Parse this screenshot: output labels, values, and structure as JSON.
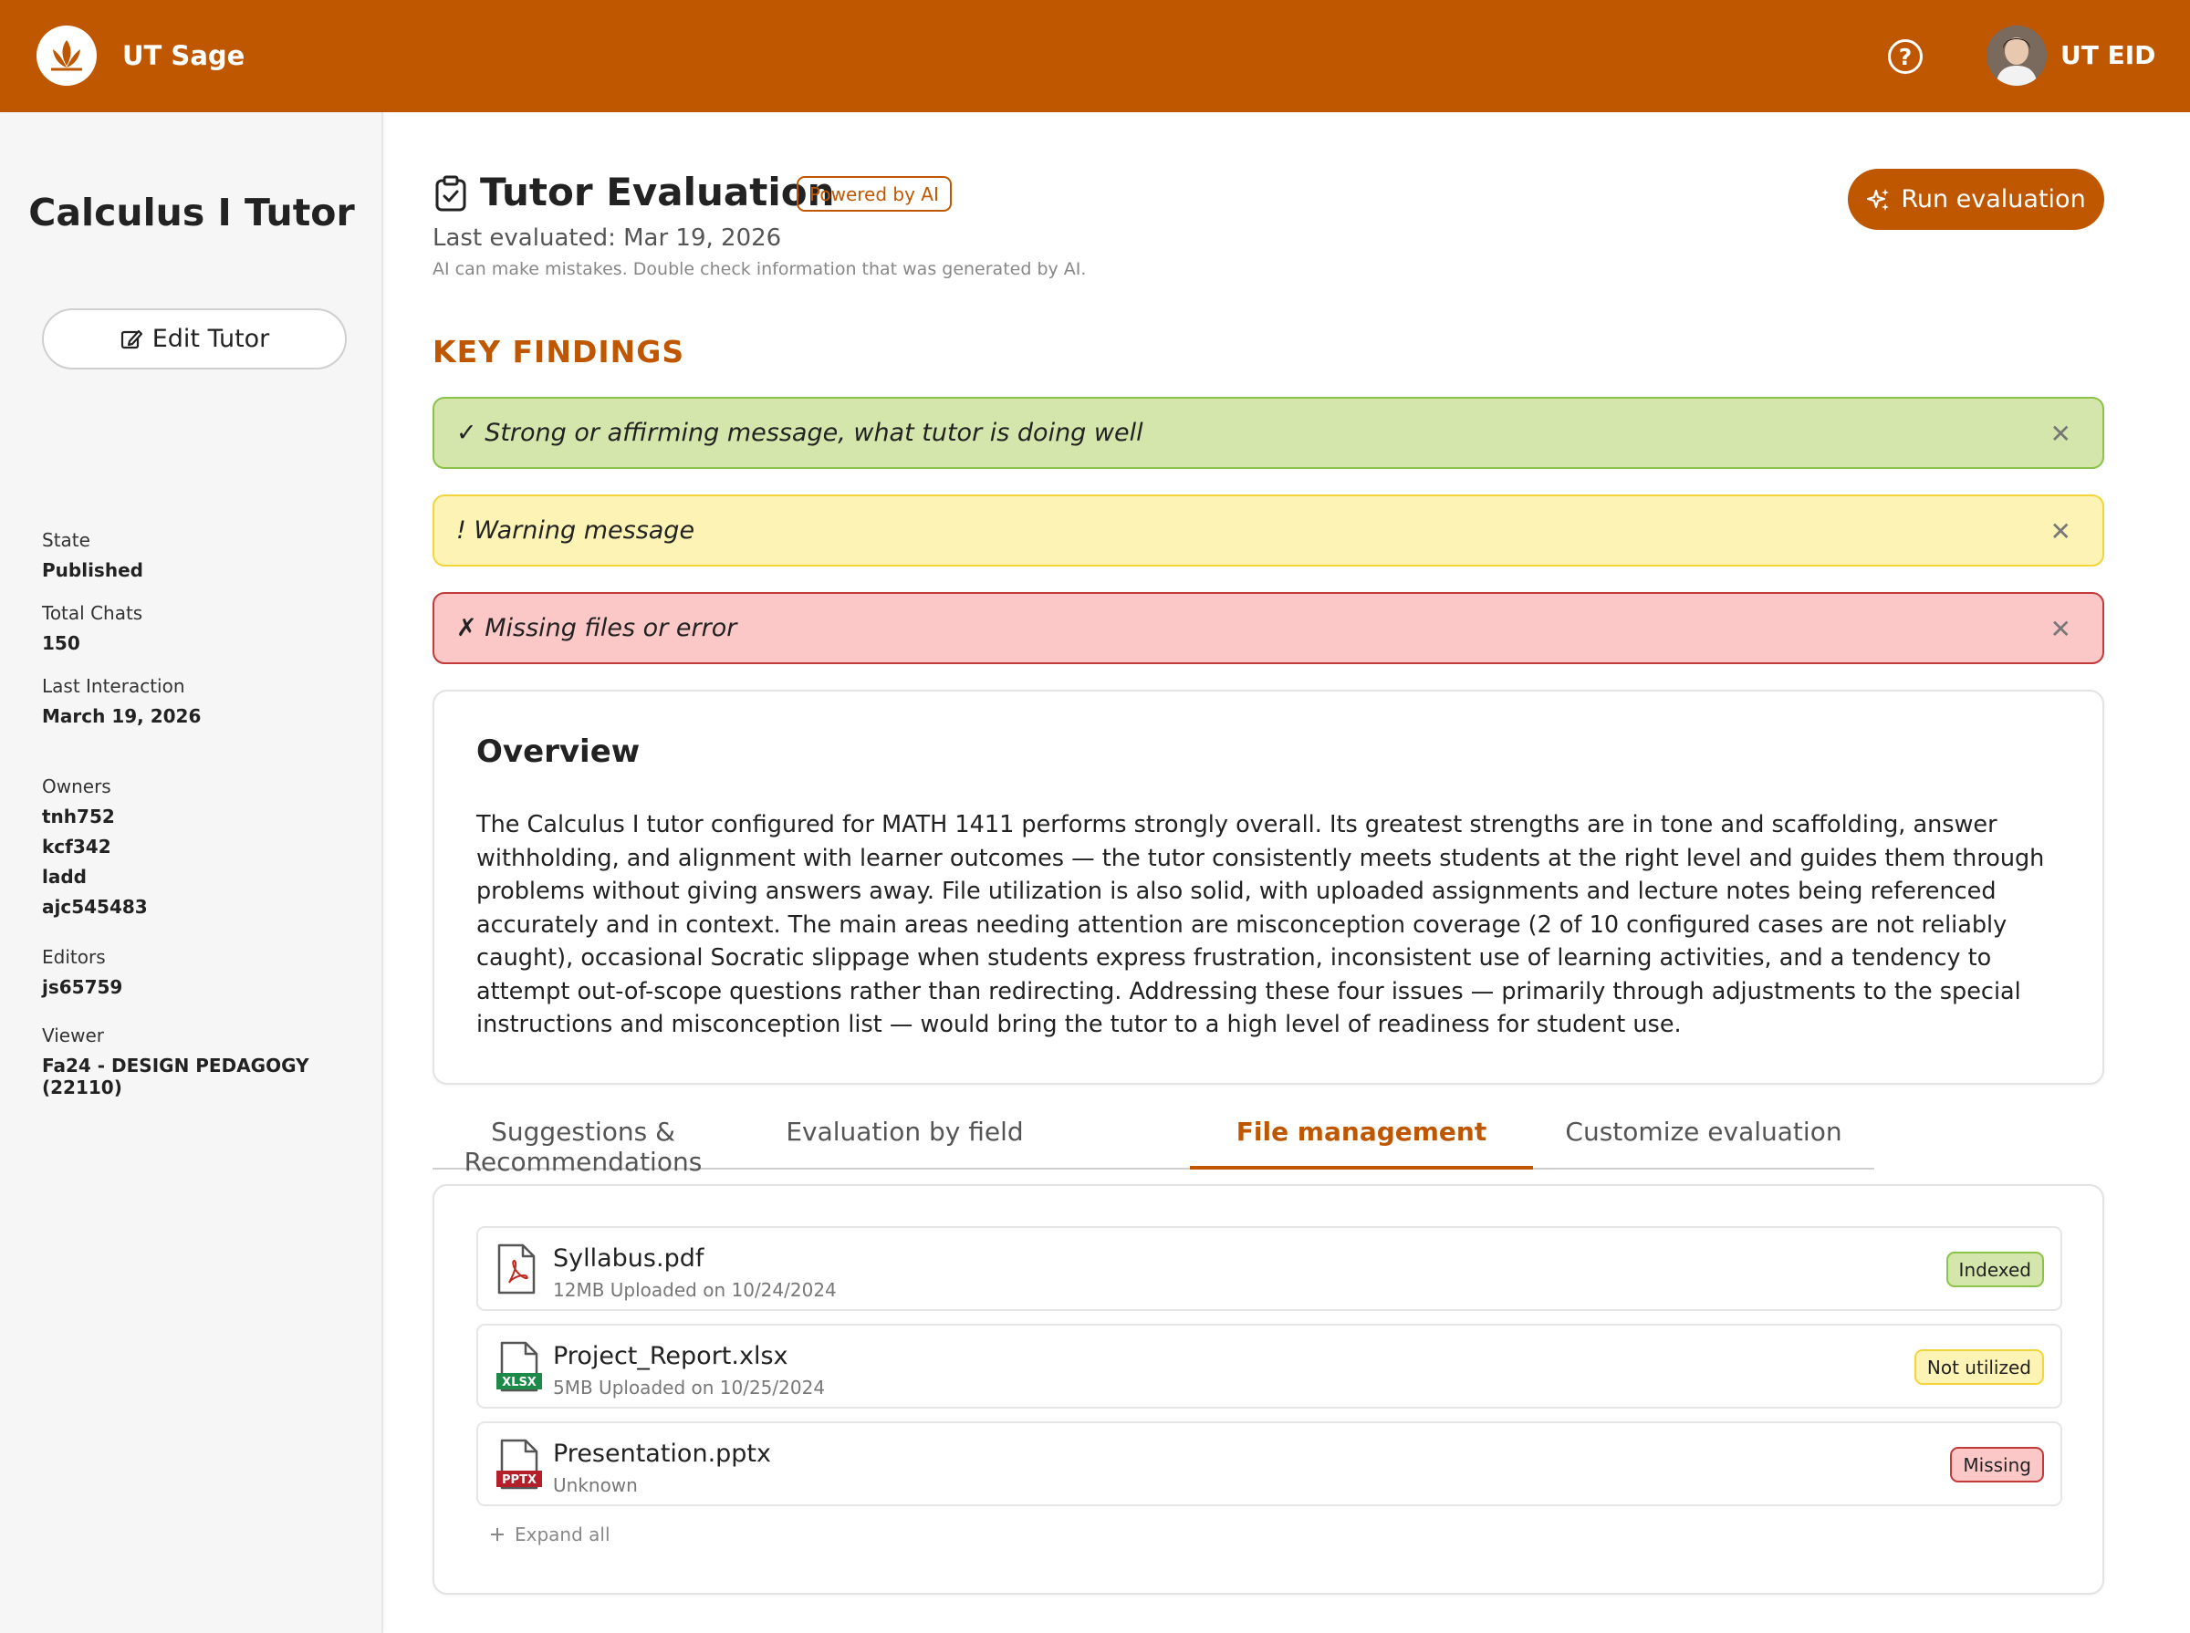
{
  "header": {
    "brand": "UT Sage",
    "user_label": "UT EID"
  },
  "sidebar": {
    "tutor_name": "Calculus I Tutor",
    "edit_label": "Edit Tutor",
    "state_label": "State",
    "state_value": "Published",
    "total_chats_label": "Total Chats",
    "total_chats_value": "150",
    "last_interaction_label": "Last Interaction",
    "last_interaction_value": "March 19, 2026",
    "owners_label": "Owners",
    "owners": [
      "tnh752",
      "kcf342",
      "ladd",
      "ajc545483"
    ],
    "editors_label": "Editors",
    "editors": [
      "js65759"
    ],
    "viewer_label": "Viewer",
    "viewer": "Fa24 - DESIGN PEDAGOGY (22110)"
  },
  "main": {
    "title": "Tutor Evaluation",
    "ai_badge": "Powered by AI",
    "last_evaluated": "Last evaluated: Mar 19, 2026",
    "disclaimer": "AI can make mistakes. Double check information that was generated by AI.",
    "run_label": "Run evaluation",
    "key_findings_title": "KEY FINDINGS",
    "alerts": [
      {
        "text": "✓ Strong or affirming message, what tutor is doing well",
        "type": "success"
      },
      {
        "text": "! Warning message",
        "type": "warning"
      },
      {
        "text": "✗ Missing files or error",
        "type": "error"
      }
    ],
    "close_glyph": "✕",
    "overview_title": "Overview",
    "overview_text": "The Calculus I tutor configured for MATH 1411 performs strongly overall. Its greatest strengths are in tone and scaffolding, answer withholding, and alignment with learner outcomes — the tutor consistently meets students at the right level and guides them through problems without giving answers away. File utilization is also solid, with uploaded assignments and lecture notes being referenced accurately and in context. The main areas needing attention are misconception coverage (2 of 10 configured cases are not reliably caught), occasional Socratic slippage when students express frustration, inconsistent use of learning activities, and a tendency to attempt out-of-scope questions rather than redirecting. Addressing these four issues — primarily through adjustments to the special instructions and misconception list — would bring the tutor to a high level of readiness for student use.",
    "tabs": [
      {
        "label": "Suggestions & Recommendations",
        "active": false
      },
      {
        "label": "Evaluation by field",
        "active": false
      },
      {
        "label": "File management",
        "active": true
      },
      {
        "label": "Customize evaluation",
        "active": false
      }
    ],
    "files": [
      {
        "name": "Syllabus.pdf",
        "size": "12MB",
        "uploaded": "Uploaded on 10/24/2024",
        "meta": "12MB  Uploaded on 10/24/2024",
        "status": "Indexed",
        "icon": "pdf-file-icon"
      },
      {
        "name": "Project_Report.xlsx",
        "size": "5MB",
        "uploaded": "Uploaded on 10/25/2024",
        "meta": "5MB  Uploaded on 10/25/2024",
        "status": "Not utilized",
        "icon": "xlsx-file-icon",
        "icon_tag": "XLSX"
      },
      {
        "name": "Presentation.pptx",
        "size": "Unknown",
        "uploaded": "",
        "meta": "Unknown",
        "status": "Missing",
        "icon": "pptx-file-icon",
        "icon_tag": "PPTX"
      }
    ],
    "expand_label": "Expand all"
  },
  "colors": {
    "brand": "#bf5700",
    "success_bg": "#d4e6ab",
    "warning_bg": "#fcf3b4",
    "error_bg": "#fcc7c7"
  }
}
